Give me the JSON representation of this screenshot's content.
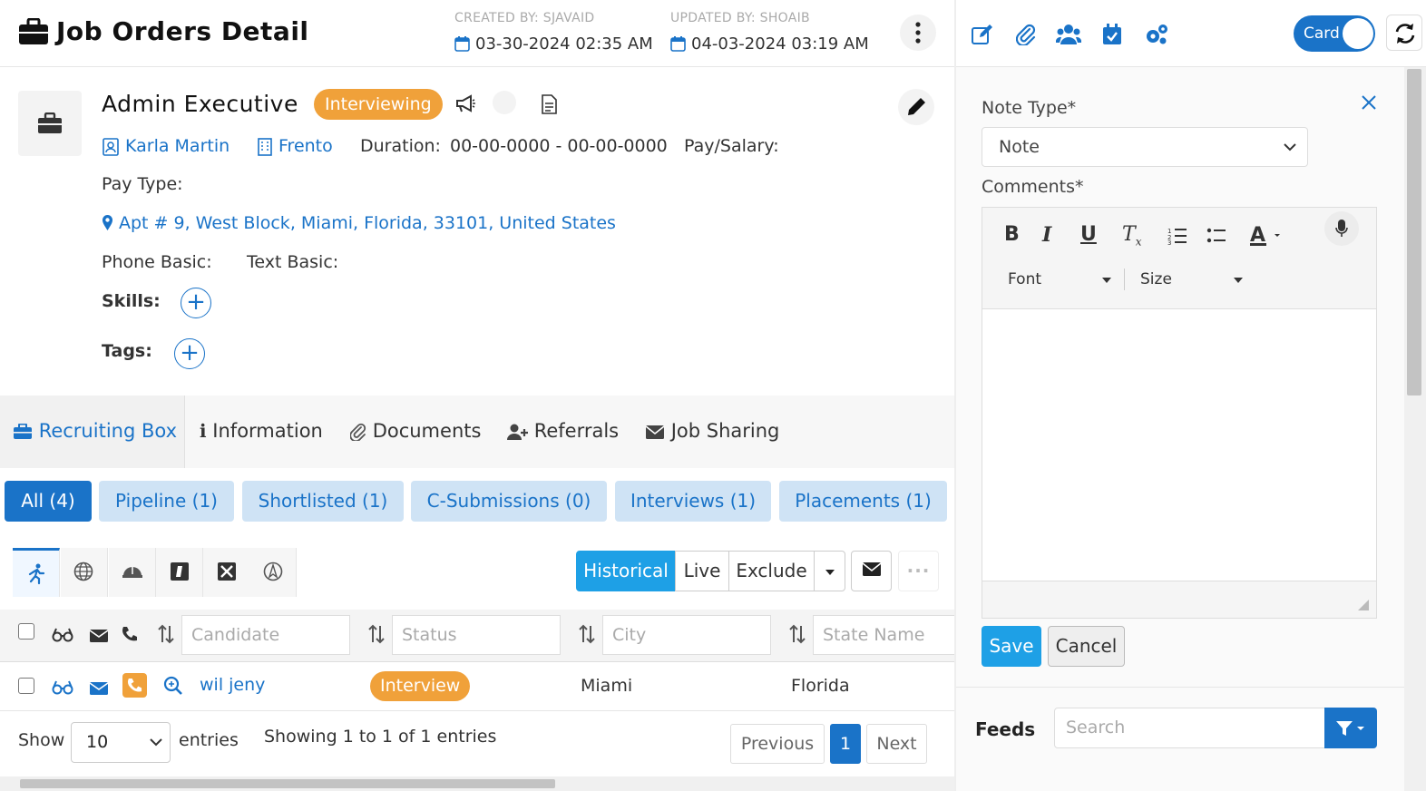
{
  "header": {
    "title": "Job Orders Detail",
    "created_by": "CREATED BY: SJAVAID",
    "created_at": "03-30-2024 02:35 AM",
    "updated_by": "UPDATED BY: SHOAIB",
    "updated_at": "04-03-2024 03:19 AM"
  },
  "toolbar": {
    "card_label": "Card",
    "icons": [
      "edit-icon",
      "paperclip-icon",
      "users-icon",
      "calendar-check-icon",
      "cogs-icon"
    ]
  },
  "job": {
    "title": "Admin Executive",
    "status": "Interviewing",
    "contact": "Karla Martin",
    "company": "Frento",
    "duration_label": "Duration:",
    "duration_value": "00-00-0000 - 00-00-0000",
    "pay_salary_label": "Pay/Salary:",
    "pay_type_label": "Pay Type:",
    "address": "Apt # 9, West Block, Miami, Florida, 33101, United States",
    "phone_label": "Phone Basic:",
    "text_label": "Text Basic:",
    "skills_label": "Skills:",
    "tags_label": "Tags:"
  },
  "tabs": [
    {
      "label": "Recruiting Box",
      "active": true
    },
    {
      "label": "Information"
    },
    {
      "label": "Documents"
    },
    {
      "label": "Referrals"
    },
    {
      "label": "Job Sharing"
    }
  ],
  "chips": [
    {
      "label": "All (4)",
      "active": true
    },
    {
      "label": "Pipeline (1)"
    },
    {
      "label": "Shortlisted (1)"
    },
    {
      "label": "C-Submissions (0)"
    },
    {
      "label": "Interviews (1)"
    },
    {
      "label": "Placements (1)"
    }
  ],
  "view_modes": {
    "historical": "Historical",
    "live": "Live",
    "exclude": "Exclude"
  },
  "table": {
    "filters": {
      "candidate": "Candidate",
      "status": "Status",
      "city": "City",
      "state": "State Name"
    },
    "rows": [
      {
        "candidate": "wil jeny",
        "status": "Interview",
        "city": "Miami",
        "state": "Florida"
      }
    ]
  },
  "footer": {
    "show_label": "Show",
    "page_size": "10",
    "entries_label": "entries",
    "info": "Showing 1 to 1 of 1 entries",
    "previous": "Previous",
    "current_page": "1",
    "next": "Next"
  },
  "note_panel": {
    "note_type_label": "Note Type*",
    "note_type_value": "Note",
    "comments_label": "Comments*",
    "font_label": "Font",
    "size_label": "Size",
    "save": "Save",
    "cancel": "Cancel",
    "feeds_label": "Feeds",
    "search_placeholder": "Search"
  },
  "colors": {
    "primary": "#1a73c8",
    "accent_orange": "#f0a13a",
    "sky": "#1ea0e6",
    "chip_bg": "#cfe3f5"
  }
}
